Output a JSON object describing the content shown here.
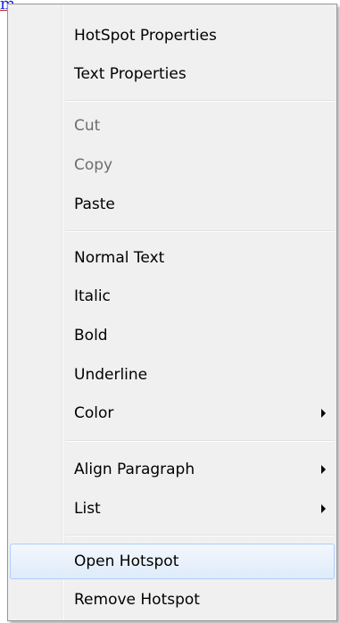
{
  "background_fragment": {
    "text": "m",
    "color": "#1b2bd6",
    "underline_color": "#c2181b"
  },
  "context_menu": {
    "items": [
      {
        "label": "HotSpot Properties",
        "enabled": true
      },
      {
        "label": "Text Properties",
        "enabled": true
      },
      {
        "label": "Cut",
        "enabled": false
      },
      {
        "label": "Copy",
        "enabled": false
      },
      {
        "label": "Paste",
        "enabled": true
      },
      {
        "label": "Normal Text",
        "enabled": true
      },
      {
        "label": "Italic",
        "enabled": true
      },
      {
        "label": "Bold",
        "enabled": true
      },
      {
        "label": "Underline",
        "enabled": true
      },
      {
        "label": "Color",
        "enabled": true,
        "submenu": true,
        "submenu_icon": "chevron-right-icon"
      },
      {
        "label": "Align Paragraph",
        "enabled": true,
        "submenu": true,
        "submenu_icon": "chevron-right-icon"
      },
      {
        "label": "List",
        "enabled": true,
        "submenu": true,
        "submenu_icon": "chevron-right-icon"
      },
      {
        "label": "Open Hotspot",
        "enabled": true,
        "highlighted": true
      },
      {
        "label": "Remove Hotspot",
        "enabled": true
      }
    ],
    "colors": {
      "menu_background": "#f0f0f0",
      "border": "#979797",
      "disabled_text": "#6d6d6d",
      "highlight_border": "#aecff7",
      "highlight_fill": "#dfebfa"
    }
  }
}
